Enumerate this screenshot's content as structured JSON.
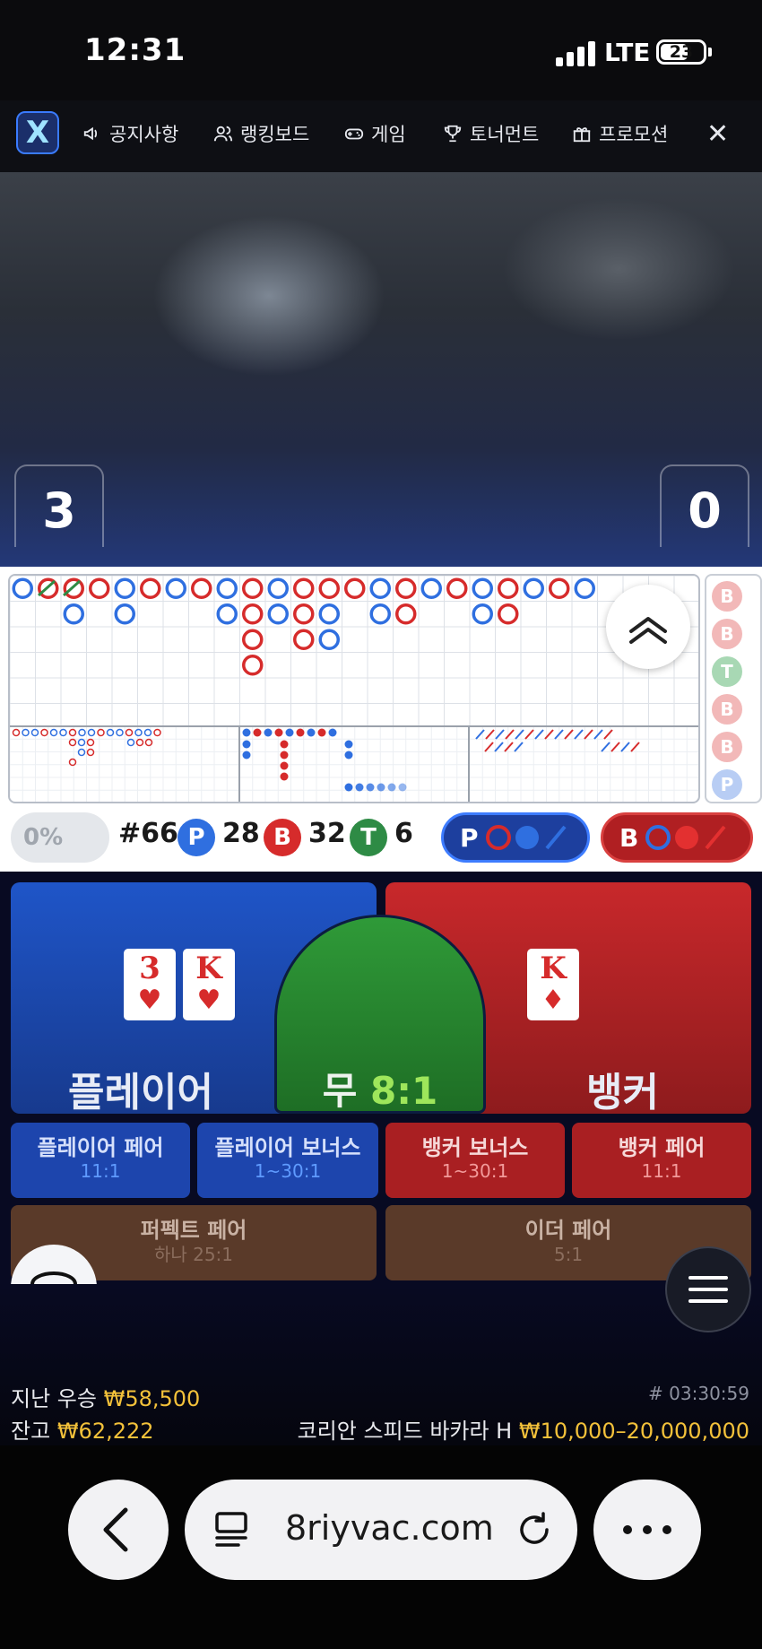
{
  "status_bar": {
    "time": "12:31",
    "network": "LTE",
    "battery": "23"
  },
  "nav": {
    "items": [
      {
        "label": "공지사항",
        "icon": "megaphone-icon"
      },
      {
        "label": "랭킹보드",
        "icon": "users-icon"
      },
      {
        "label": "게임",
        "icon": "gamepad-icon"
      },
      {
        "label": "토너먼트",
        "icon": "trophy-icon"
      },
      {
        "label": "프로모션",
        "icon": "gift-icon"
      }
    ]
  },
  "scores": {
    "player": "3",
    "banker": "0"
  },
  "bead_road": [
    "B",
    "B",
    "T",
    "B",
    "B",
    "P"
  ],
  "stats": {
    "percent": "0%",
    "round": "#66",
    "player_badge": "P",
    "player_count": "28",
    "banker_badge": "B",
    "banker_count": "32",
    "tie_badge": "T",
    "tie_count": "6",
    "predict_player": "P",
    "predict_banker": "B"
  },
  "bets": {
    "player_label": "플레이어",
    "tie_label": "무",
    "tie_odds": "8:1",
    "banker_label": "뱅커",
    "player_cards": [
      {
        "rank": "3",
        "suit": "♥"
      },
      {
        "rank": "K",
        "suit": "♥"
      }
    ],
    "banker_cards": [
      {
        "rank": "K",
        "suit": "♦"
      }
    ],
    "side_bets": [
      {
        "name": "플레이어 페어",
        "odds": "11:1"
      },
      {
        "name": "플레이어 보너스",
        "odds": "1~30:1"
      },
      {
        "name": "뱅커 보너스",
        "odds": "1~30:1"
      },
      {
        "name": "뱅커 페어",
        "odds": "11:1"
      }
    ],
    "perfect_pair": {
      "name": "퍼펙트 페어",
      "odds": "하나 25:1"
    },
    "either_pair": {
      "name": "이더 페어",
      "odds": "5:1"
    }
  },
  "info": {
    "last_win_label": "지난 우승",
    "last_win_value": "₩58,500",
    "balance_label": "잔고",
    "balance_value": "₩62,222",
    "game_id": "# 03:30:59",
    "table_name": "코리안 스피드 바카라 H",
    "limits": "₩10,000–20,000,000"
  },
  "browser": {
    "url": "8riyvac.com"
  },
  "colors": {
    "player": "#2f6fe0",
    "banker": "#d62b2b",
    "tie": "#2e8b45",
    "gold": "#f3c13a"
  }
}
